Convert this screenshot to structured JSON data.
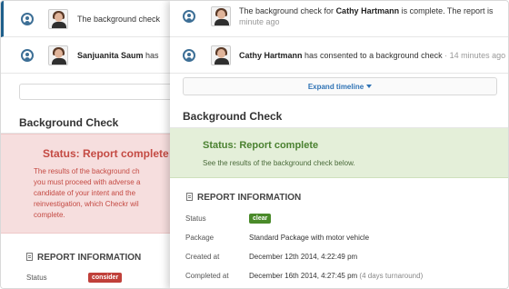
{
  "back": {
    "timeline": [
      {
        "text": "The background check"
      },
      {
        "name": "Sanjuanita Saum",
        "text_after": " has"
      }
    ],
    "title": "Background Check",
    "status_title": "Status: Report complete",
    "status_lines": [
      "The results of the background ch",
      "you must proceed with adverse a",
      "candidate of your intent and the",
      "reinvestigation, which Checkr wil",
      "complete."
    ],
    "report_heading": "REPORT INFORMATION",
    "status_label": "Status",
    "status_badge": "consider"
  },
  "front": {
    "timeline": [
      {
        "text_before": "The background check for ",
        "name": "Cathy Hartmann",
        "text_after": " is complete. The report is",
        "time": "minute ago"
      },
      {
        "name": "Cathy Hartmann",
        "text_after": " has consented to a background check",
        "time": " · 14 minutes ago"
      }
    ],
    "expand_label": "Expand timeline",
    "title": "Background Check",
    "status_title": "Status: Report complete",
    "status_text": "See the results of the background check below.",
    "report_heading": "REPORT INFORMATION",
    "info": {
      "status_label": "Status",
      "status_badge": "clear",
      "package_label": "Package",
      "package_value": "Standard Package with motor vehicle",
      "created_label": "Created at",
      "created_value": "December 12th 2014, 4:22:49 pm",
      "completed_label": "Completed at",
      "completed_value": "December 16th 2014, 4:27:45 pm",
      "completed_note": "(4 days turnaround)"
    }
  },
  "colors": {
    "consider": "#c0403a",
    "clear": "#4a8a2a",
    "report_complete_red": "#c44a43",
    "report_complete_green": "#4a8130",
    "link": "#2f73b5"
  },
  "icons": [
    "candidate-icon",
    "avatar",
    "document-icon",
    "caret-down-icon"
  ]
}
